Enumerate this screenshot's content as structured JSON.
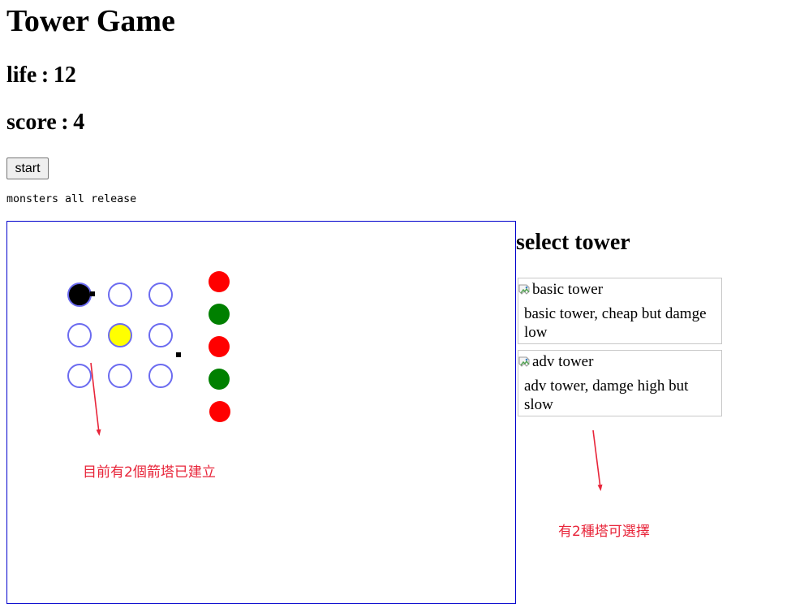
{
  "header": {
    "title": "Tower Game",
    "life_label": "life",
    "life_value": "12",
    "score_label": "score",
    "score_value": "4",
    "separator": ":"
  },
  "controls": {
    "start_label": "start",
    "status": "monsters all release"
  },
  "board": {
    "border_color": "#0000cc",
    "slot_color": "#6b6bf0",
    "towers": [
      {
        "kind": "basic",
        "color": "#000000"
      },
      {
        "kind": "adv",
        "color": "#ffff00"
      }
    ],
    "monster_colors": [
      "#ff0000",
      "#008000",
      "#ff0000",
      "#008000",
      "#ff0000"
    ]
  },
  "select": {
    "title": "select tower",
    "towers": [
      {
        "alt": "basic tower",
        "desc": "basic tower, cheap but damge low"
      },
      {
        "alt": "adv tower",
        "desc": "adv tower, damge high but slow"
      }
    ]
  },
  "annotations": {
    "board_note": "目前有2個箭塔已建立",
    "select_note": "有2種塔可選擇",
    "color": "#e8253a"
  }
}
